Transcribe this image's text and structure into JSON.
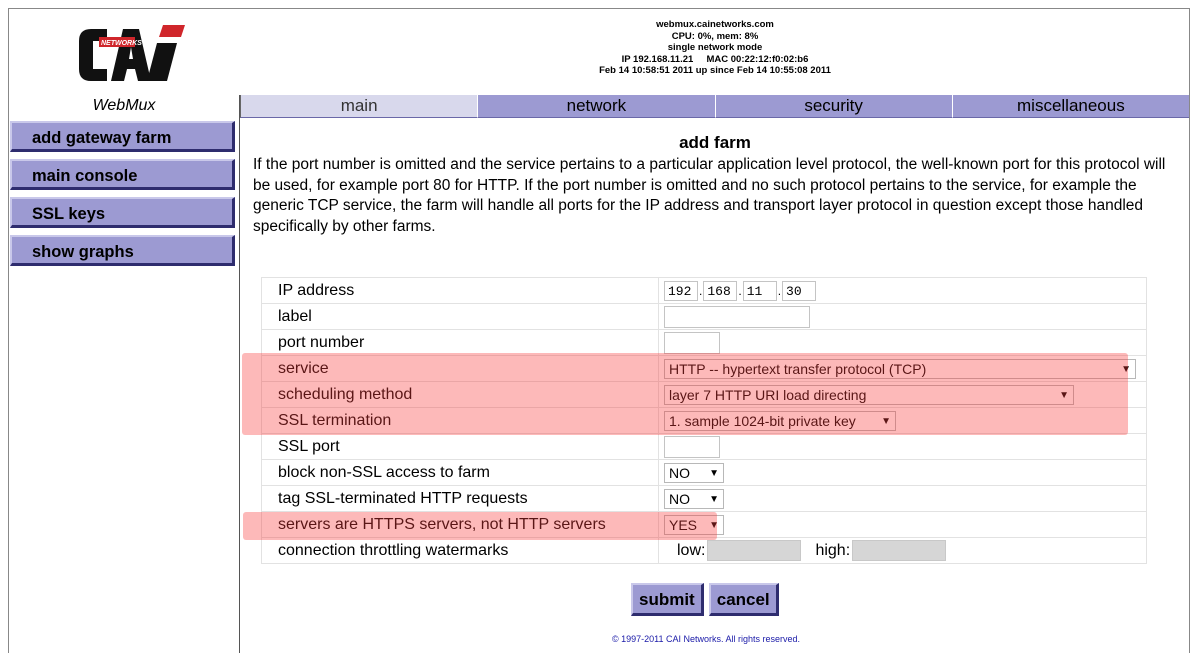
{
  "header": {
    "logo_text": "CAi",
    "logo_sub": "NETWORKS",
    "hostname": "webmux.cainetworks.com",
    "cpu_mem": "CPU: 0%, mem: 8%",
    "mode": "single network mode",
    "ip_mac": "IP 192.168.11.21     MAC 00:22:12:f0:02:b6",
    "uptime": "Feb 14 10:58:51 2011 up since Feb 14 10:55:08 2011",
    "brand": "WebMux"
  },
  "tabs": [
    {
      "label": "main",
      "active": true
    },
    {
      "label": "network"
    },
    {
      "label": "security"
    },
    {
      "label": "miscellaneous"
    }
  ],
  "sidebar": {
    "items": [
      {
        "label": "add gateway farm"
      },
      {
        "label": "main console"
      },
      {
        "label": "SSL keys"
      },
      {
        "label": "show graphs"
      }
    ]
  },
  "main": {
    "title": "add farm",
    "description": "If the port number is omitted and the service pertains to a particular application level protocol, the well-known port for this protocol will be used, for example port 80 for HTTP. If the port number is omitted and no such protocol pertains to the service, for example the generic TCP service, the farm will handle all ports for the IP address and transport layer protocol in question except those handled specifically by other farms."
  },
  "form": {
    "ip_label": "IP address",
    "ip": [
      "192",
      "168",
      "11",
      "30"
    ],
    "label_label": "label",
    "label_value": "",
    "port_label": "port number",
    "port_value": "",
    "service_label": "service",
    "service_value": "HTTP -- hypertext transfer protocol (TCP)",
    "scheduling_label": "scheduling method",
    "scheduling_value": "layer 7 HTTP URI load directing",
    "ssl_term_label": "SSL termination",
    "ssl_term_value": "1. sample 1024-bit private key",
    "ssl_port_label": "SSL port",
    "ssl_port_value": "",
    "block_label": "block non-SSL access to farm",
    "block_value": "NO",
    "tag_label": "tag SSL-terminated HTTP requests",
    "tag_value": "NO",
    "https_label": "servers are HTTPS servers, not HTTP servers",
    "https_value": "YES",
    "throttle_label": "connection throttling watermarks",
    "low_label": "low:",
    "high_label": "high:"
  },
  "buttons": {
    "submit": "submit",
    "cancel": "cancel"
  },
  "footer": {
    "copyright": "© 1997-2011 CAI Networks. All rights reserved."
  },
  "colors": {
    "tab_bg": "#9c9ad2",
    "tab_active_bg": "#d8d8ec",
    "highlight": "#f77b7b",
    "logo_red": "#d0262b"
  }
}
